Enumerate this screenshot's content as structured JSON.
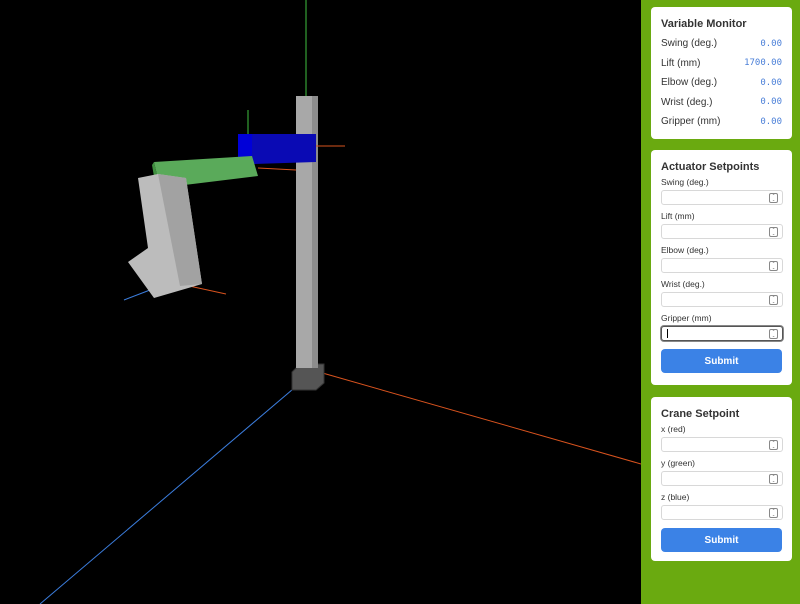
{
  "monitor": {
    "title": "Variable Monitor",
    "rows": [
      {
        "label": "Swing (deg.)",
        "value": "0.00"
      },
      {
        "label": "Lift (mm)",
        "value": "1700.00"
      },
      {
        "label": "Elbow (deg.)",
        "value": "0.00"
      },
      {
        "label": "Wrist (deg.)",
        "value": "0.00"
      },
      {
        "label": "Gripper (mm)",
        "value": "0.00"
      }
    ]
  },
  "actuator": {
    "title": "Actuator Setpoints",
    "fields": [
      {
        "label": "Swing (deg.)",
        "value": ""
      },
      {
        "label": "Lift (mm)",
        "value": ""
      },
      {
        "label": "Elbow (deg.)",
        "value": ""
      },
      {
        "label": "Wrist (deg.)",
        "value": ""
      },
      {
        "label": "Gripper (mm)",
        "value": ""
      }
    ],
    "submit_label": "Submit"
  },
  "crane": {
    "title": "Crane Setpoint",
    "fields": [
      {
        "label": "x (red)",
        "value": ""
      },
      {
        "label": "y (green)",
        "value": ""
      },
      {
        "label": "z (blue)",
        "value": ""
      }
    ],
    "submit_label": "Submit"
  },
  "colors": {
    "sidebar_bg": "#6aaa10",
    "button": "#3b82e6",
    "value_text": "#4a7fd8",
    "x_axis": "red",
    "y_axis": "green",
    "z_axis": "blue"
  }
}
